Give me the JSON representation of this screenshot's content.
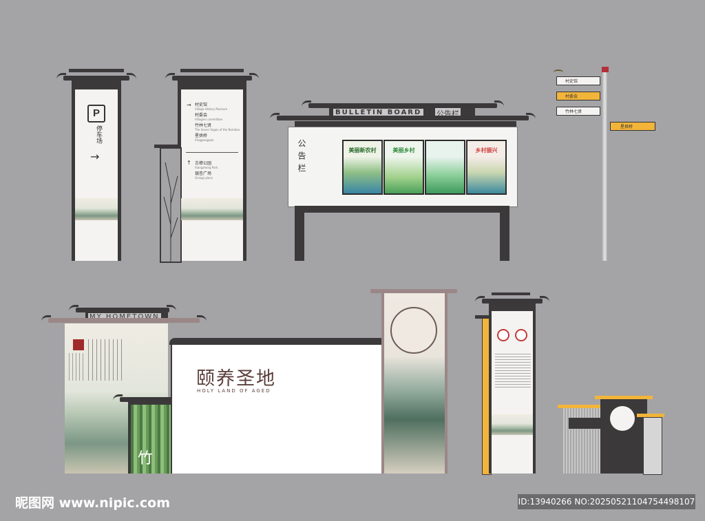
{
  "parking_sign": {
    "letter": "P",
    "label": "停车场",
    "arrow": "→"
  },
  "directory_sign": {
    "items": [
      {
        "cn": "村史馆",
        "en": "Village History Museum"
      },
      {
        "cn": "村委会",
        "en": "Villagers committee"
      },
      {
        "cn": "竹林七贤",
        "en": "The Seven Sages of the Bamboo"
      },
      {
        "cn": "星拱桥",
        "en": "Xinggongqiao"
      }
    ],
    "items2": [
      {
        "cn": "古樟公园",
        "en": "Xiangzhang Park"
      },
      {
        "cn": "银杏广场",
        "en": "Ginkgo place"
      }
    ],
    "arrow_up": "↑",
    "arrow_right": "→"
  },
  "bulletin": {
    "title_en": "BULLETIN BOARD",
    "title_cn": "公告栏",
    "side_label": "公告栏",
    "posters": [
      "美丽新农村",
      "美丽乡村",
      "",
      "乡村振兴"
    ]
  },
  "fingerpost": {
    "arms": [
      "村史馆",
      "村委会",
      "竹林七贤",
      "星拱桥"
    ]
  },
  "gate": {
    "arch_text": "MY HOMETOWN",
    "bamboo": "竹"
  },
  "main_sign": {
    "title_cn": "颐养圣地",
    "title_en": "HOLY LAND OF AGED"
  },
  "info_stand": {},
  "watermark": {
    "left": "昵图网 www.nipic.com",
    "right": "ID:13940266 NO:20250521104754498107"
  },
  "colors": {
    "background": "#a4a3a6",
    "dark": "#3b393a",
    "accent": "#f2b53a"
  }
}
